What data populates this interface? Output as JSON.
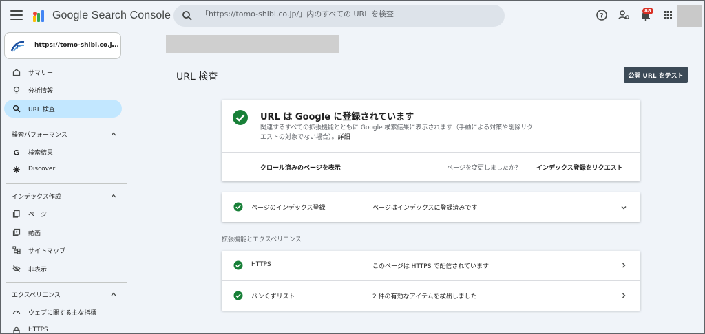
{
  "header": {
    "app_name": "Google Search Console",
    "search_placeholder": "「https://tomo-shibi.co.jp/」内のすべての URL を検査",
    "notification_count": "88"
  },
  "sidebar": {
    "property_label": "https://tomo-shibi.co.j...",
    "items_top": [
      {
        "label": "サマリー",
        "icon": "home-icon"
      },
      {
        "label": "分析情報",
        "icon": "lightbulb-icon"
      },
      {
        "label": "URL 検査",
        "icon": "search-icon",
        "active": true
      }
    ],
    "sections": [
      {
        "title": "検索パフォーマンス",
        "items": [
          {
            "label": "検索結果",
            "icon": "google-g-icon"
          },
          {
            "label": "Discover",
            "icon": "asterisk-icon"
          }
        ]
      },
      {
        "title": "インデックス作成",
        "items": [
          {
            "label": "ページ",
            "icon": "pages-icon"
          },
          {
            "label": "動画",
            "icon": "video-icon"
          },
          {
            "label": "サイトマップ",
            "icon": "sitemap-icon"
          },
          {
            "label": "非表示",
            "icon": "eye-off-icon"
          }
        ]
      },
      {
        "title": "エクスペリエンス",
        "items": [
          {
            "label": "ウェブに関する主な指標",
            "icon": "speedometer-icon"
          },
          {
            "label": "HTTPS",
            "icon": "lock-icon"
          }
        ]
      }
    ]
  },
  "main": {
    "page_title": "URL 検査",
    "test_button": "公開 URL をテスト",
    "status": {
      "title": "URL は Google に登録されています",
      "description": "関連するすべての拡張機能とともに Google 検索結果に表示されます（手動による対策や削除リクエストの対象でない場合）。",
      "detail_link": "詳細",
      "crawled_link": "クロール済みのページを表示",
      "changed_question": "ページを変更しましたか？",
      "request_link": "インデックス登録をリクエスト"
    },
    "index_row": {
      "label": "ページのインデックス登録",
      "value": "ページはインデックスに登録済みです"
    },
    "enhancements_title": "拡張機能とエクスペリエンス",
    "enhancements": [
      {
        "label": "HTTPS",
        "value": "このページは HTTPS で配信されています"
      },
      {
        "label": "パンくずリスト",
        "value": "2 件の有効なアイテムを検出しました"
      }
    ]
  },
  "colors": {
    "accent_green": "#188038",
    "active_nav": "#c2e7ff",
    "button_bg": "#3c4a57"
  }
}
